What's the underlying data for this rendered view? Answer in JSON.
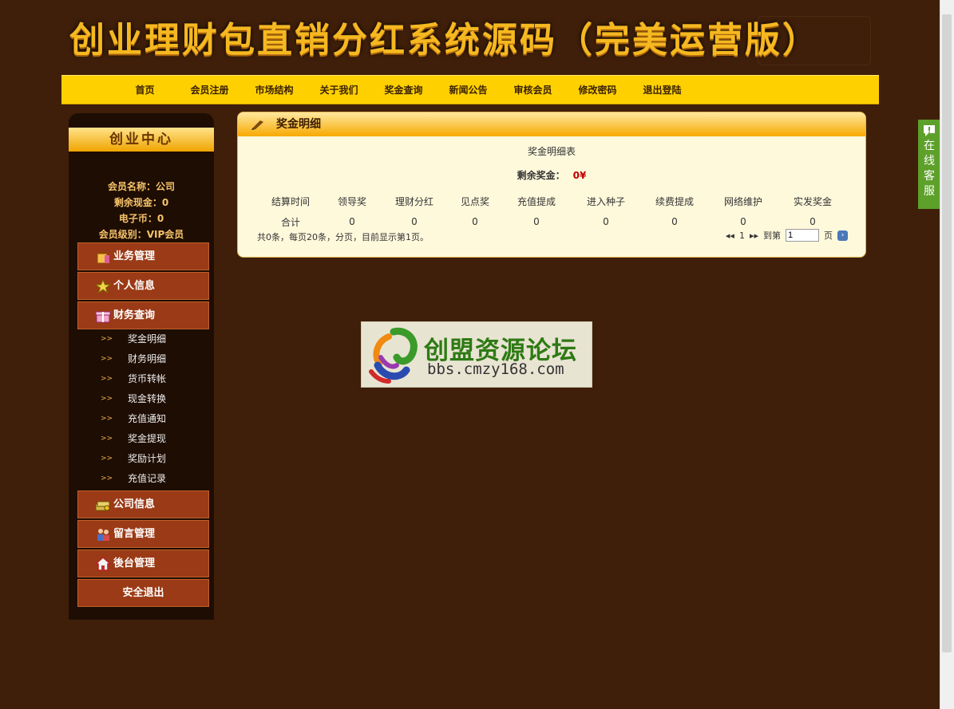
{
  "banner": {
    "title": "创业理财包直销分红系统源码（完美运营版）"
  },
  "top_nav": [
    "首页",
    "会员注册",
    "市场结构",
    "关于我们",
    "奖金查询",
    "新闻公告",
    "审核会员",
    "修改密码",
    "退出登陆"
  ],
  "sidebar": {
    "heading": "创业中心",
    "member": {
      "name": "会员名称：公司",
      "cash": "剩余现金：0",
      "ecoin": "电子币：0",
      "level": "会员级别：VIP会员"
    },
    "menus": {
      "business": "业务管理",
      "personal": "个人信息",
      "finance": "财务查询",
      "company": "公司信息",
      "message": "留言管理",
      "admin": "後台管理",
      "logout": "安全退出"
    },
    "finance_items": [
      "奖金明细",
      "财务明细",
      "货币转帐",
      "现金转换",
      "充值通知",
      "奖金提现",
      "奖励计划",
      "充值记录"
    ],
    "arrow_glyph": ">>"
  },
  "panel": {
    "title": "奖金明细",
    "caption": "奖金明细表",
    "remaining_label": "剩余奖金：",
    "remaining_value": "0¥",
    "columns": [
      "结算时间",
      "领导奖",
      "理财分红",
      "见点奖",
      "充值提成",
      "进入种子",
      "续费提成",
      "网络维护",
      "实发奖金"
    ],
    "totals": [
      "合计",
      "0",
      "0",
      "0",
      "0",
      "0",
      "0",
      "0",
      "0"
    ],
    "summary": "共0条，每页20条，分页，目前显示第1页。",
    "pager": {
      "first": "◂◂",
      "page": "1",
      "next": "▸▸",
      "goto_label": "到第",
      "input_value": "1",
      "suffix": "页",
      "go": "›"
    }
  },
  "watermark": {
    "title": "创盟资源论坛",
    "url": "bbs.cmzy168.com"
  },
  "service_tab": {
    "chars": [
      "在",
      "线",
      "客",
      "服"
    ]
  },
  "colors": {
    "background": "#3f1f0a",
    "nav": "#ffd000",
    "menu": "#9b3a16",
    "panel": "#fff9dc",
    "service": "#5da02a"
  }
}
